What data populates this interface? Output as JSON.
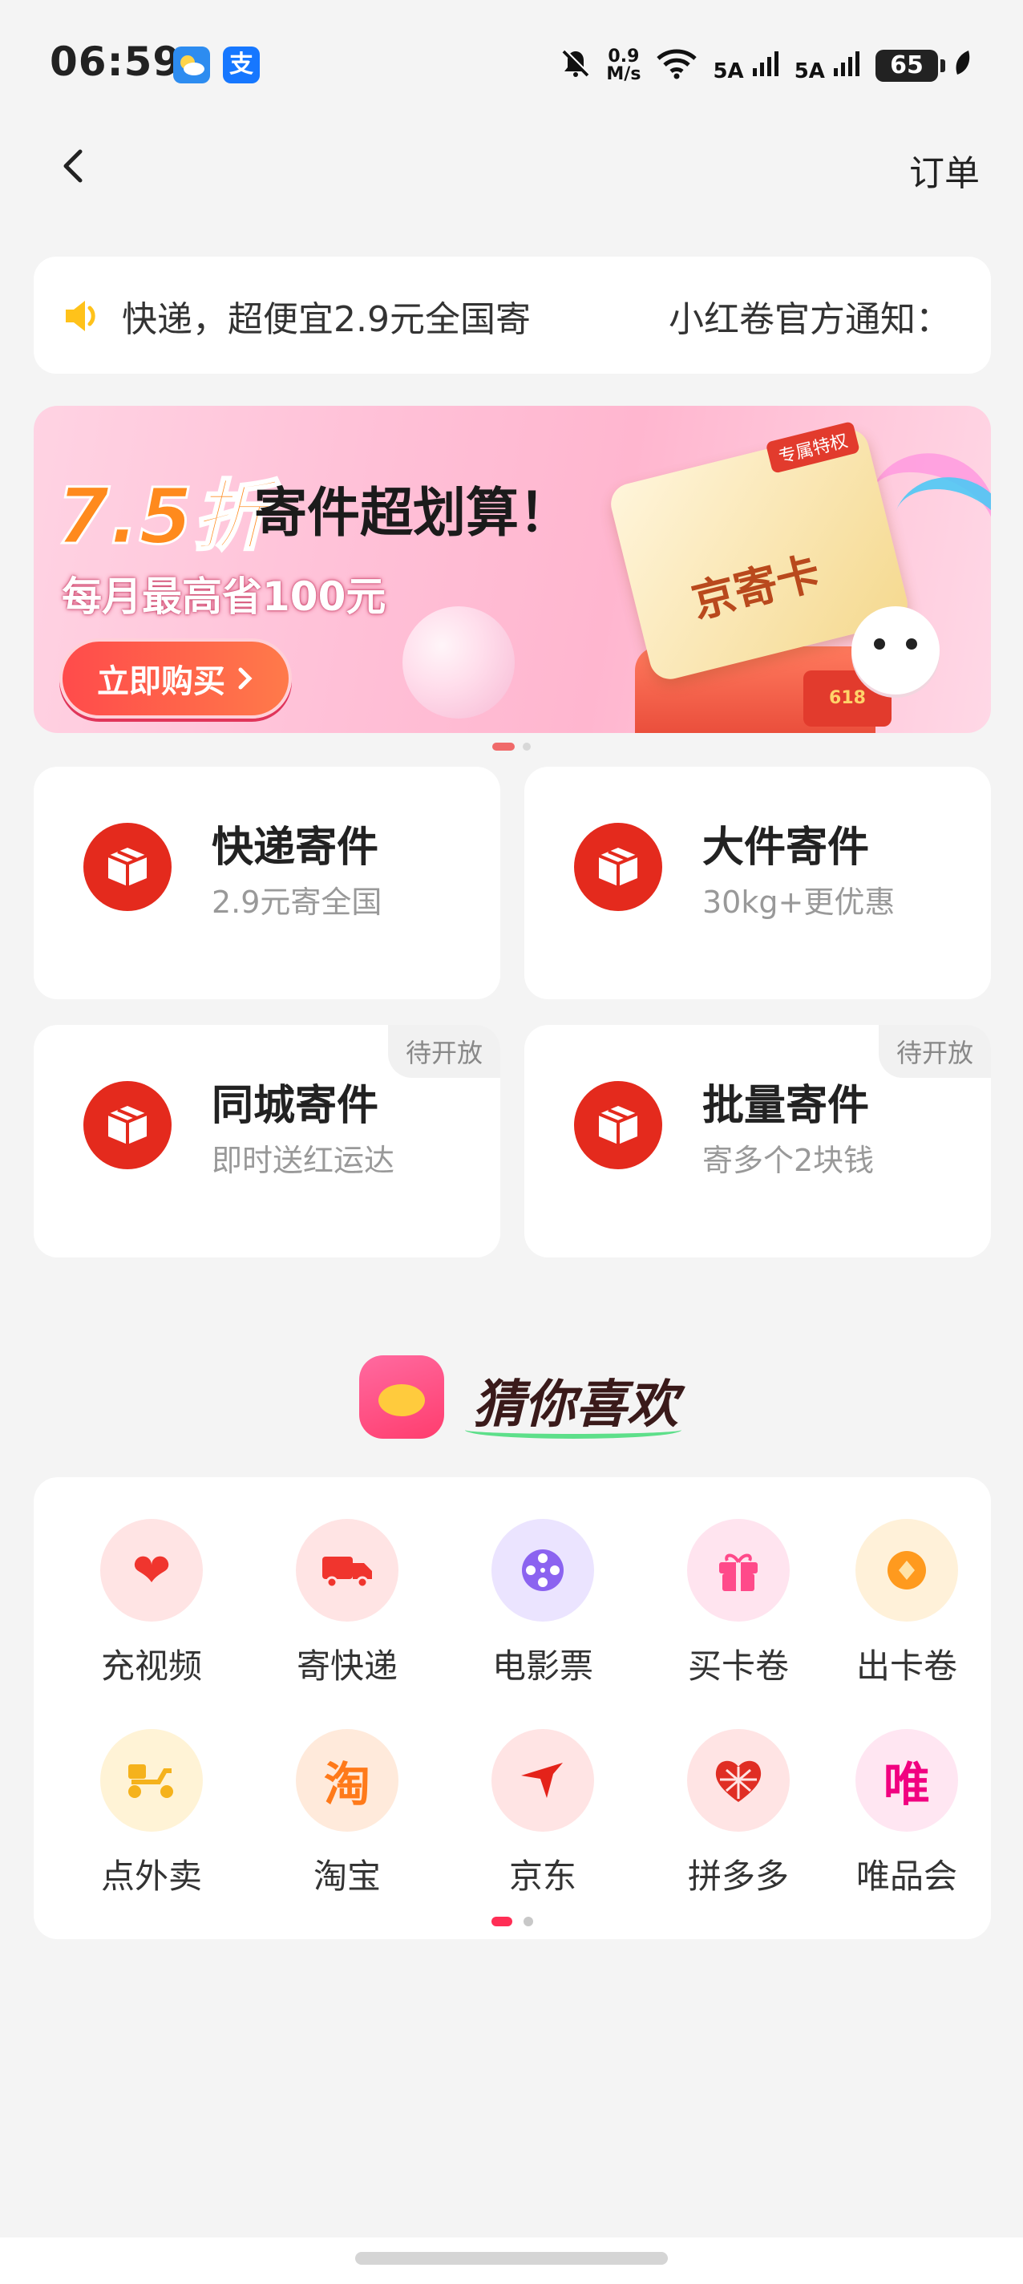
{
  "status_bar": {
    "time": "06:59",
    "app_icons": [
      {
        "name": "weather-icon",
        "color": "#2d8cf0"
      },
      {
        "name": "alipay-icon",
        "glyph": "支",
        "color": "#1677ff"
      }
    ],
    "net_speed_value": "0.9",
    "net_speed_unit": "M/s",
    "signal1": "5A",
    "signal2": "5A",
    "battery": "65"
  },
  "nav": {
    "back_icon": "chevron-left-icon",
    "order_label": "订单"
  },
  "notice": {
    "icon": "speaker-icon",
    "text1": "快递，超便宜2.9元全国寄",
    "text2": "小红卷官方通知："
  },
  "banner": {
    "discount": "7.5折",
    "headline": "寄件超划算！",
    "subline": "每月最高省100元",
    "button_label": "立即购买",
    "card_label": "京寄卡",
    "card_tag": "专属特权",
    "gift_label": "618",
    "accent_color": "#ff8a1d"
  },
  "services": [
    {
      "title": "快递寄件",
      "subtitle": "2.9元寄全国",
      "tag": ""
    },
    {
      "title": "大件寄件",
      "subtitle": "30kg+更优惠",
      "tag": ""
    },
    {
      "title": "同城寄件",
      "subtitle": "即时送红运达",
      "tag": "待开放"
    },
    {
      "title": "批量寄件",
      "subtitle": "寄多个2块钱",
      "tag": "待开放"
    }
  ],
  "guess": {
    "title": "猜你喜欢"
  },
  "grid": [
    {
      "label": "充视频",
      "icon": "video-heart-icon",
      "glyph": "❤",
      "bg": "#ffe4e4",
      "color": "#f0352e"
    },
    {
      "label": "寄快递",
      "icon": "truck-icon",
      "glyph": "🚚",
      "bg": "#ffe4e4",
      "color": "#f0352e"
    },
    {
      "label": "电影票",
      "icon": "film-reel-icon",
      "glyph": "✇",
      "bg": "#ebe4ff",
      "color": "#8b63f0"
    },
    {
      "label": "买卡卷",
      "icon": "gift-icon",
      "glyph": "🎁",
      "bg": "#ffe4ef",
      "color": "#ff4a8a"
    },
    {
      "label": "出卡卷",
      "icon": "coin-icon",
      "glyph": "◆",
      "bg": "#fff1d9",
      "color": "#ff9a1e"
    },
    {
      "label": "点外卖",
      "icon": "scooter-icon",
      "glyph": "🛵",
      "bg": "#fff3d6",
      "color": "#f5b21c"
    },
    {
      "label": "淘宝",
      "icon": "taobao-icon",
      "glyph": "淘",
      "bg": "#ffeadb",
      "color": "#ff7a1a"
    },
    {
      "label": "京东",
      "icon": "jd-icon",
      "glyph": "✈",
      "bg": "#ffe4e4",
      "color": "#e4231a"
    },
    {
      "label": "拼多多",
      "icon": "pinduoduo-icon",
      "glyph": "❖",
      "bg": "#ffe4e4",
      "color": "#e02e24"
    },
    {
      "label": "唯品会",
      "icon": "vipshop-icon",
      "glyph": "唯",
      "bg": "#ffe6f2",
      "color": "#f10180"
    }
  ]
}
